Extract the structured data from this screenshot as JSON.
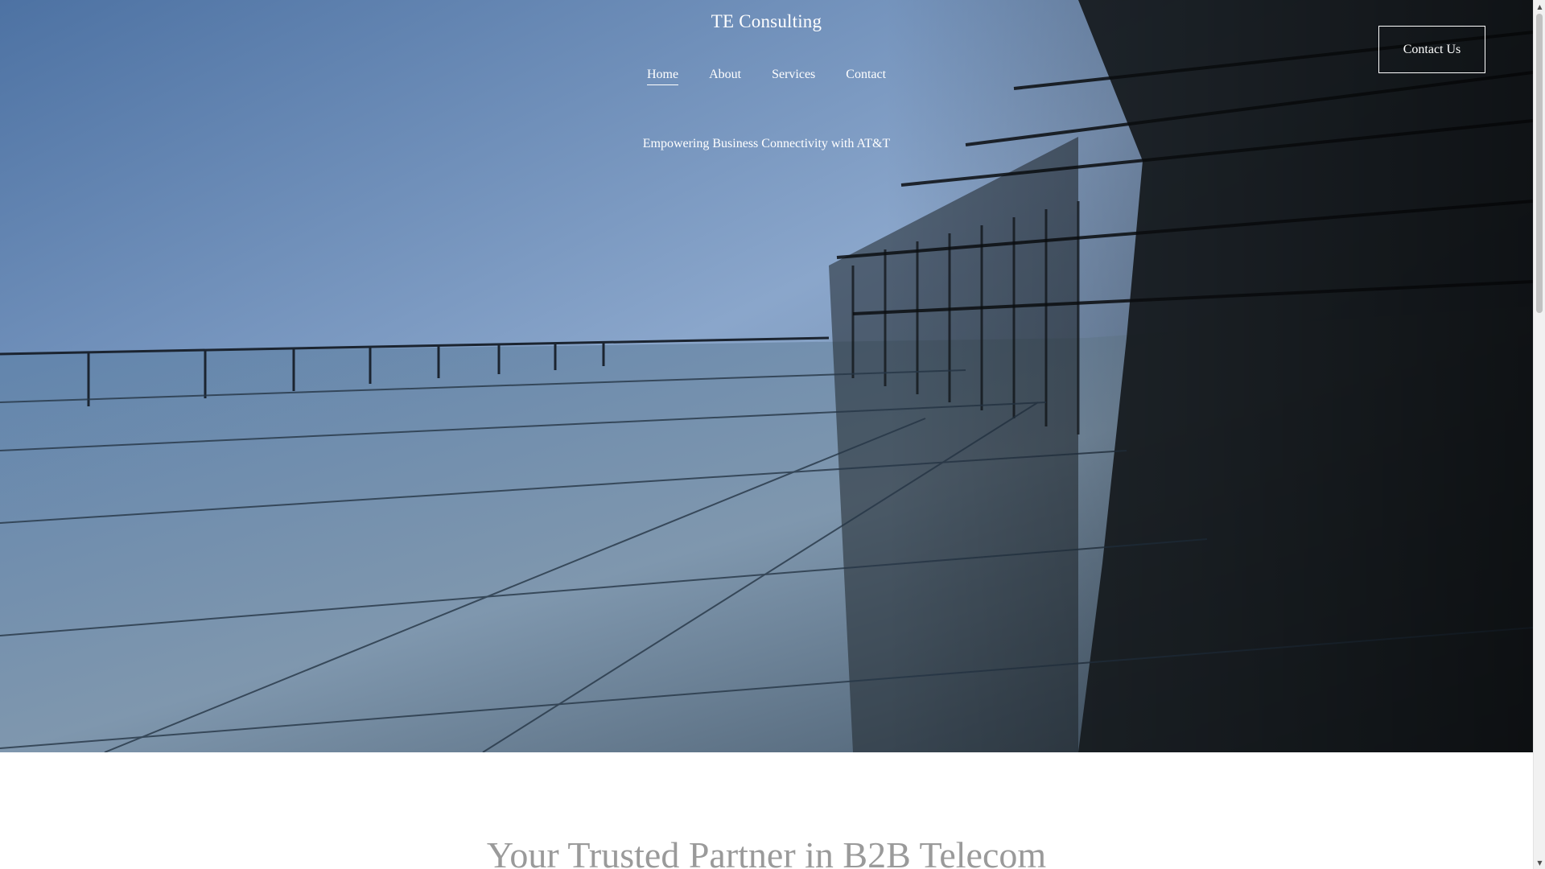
{
  "header": {
    "site_title": "TE Consulting",
    "contact_button_label": "Contact Us"
  },
  "nav": {
    "items": [
      {
        "label": "Home",
        "active": true
      },
      {
        "label": "About",
        "active": false
      },
      {
        "label": "Services",
        "active": false
      },
      {
        "label": "Contact",
        "active": false
      }
    ]
  },
  "hero": {
    "tagline": "Empowering Business Connectivity with AT&T",
    "image_description_icon": "building-glass-facade-image"
  },
  "main": {
    "section_heading": "Your Trusted Partner in B2B Telecom"
  },
  "colors": {
    "hero_sky": "#7e9ec8",
    "text_on_hero": "#ffffff",
    "heading_gray": "#9a9a9a"
  }
}
